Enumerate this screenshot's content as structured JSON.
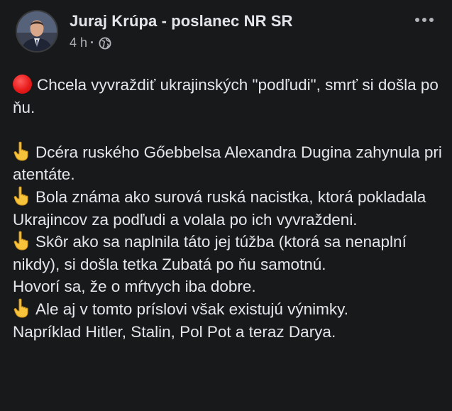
{
  "post": {
    "author": "Juraj Krúpa - poslanec NR SR",
    "time": "4 h",
    "separator": "·",
    "privacy_icon": "globe-icon",
    "more_icon": "more-options-icon",
    "avatar_icon": "profile-photo"
  },
  "body": {
    "line1": "Chcela vyvraždiť ukrajinských \"podľudi\", smrť si došla po ňu.",
    "line2": "Dcéra ruského Gőebbelsa Alexandra Dugina zahynula pri atentáte.",
    "line3": "Bola známa ako surová ruská nacistka, ktorá pokladala Ukrajincov za podľudi a volala po ich vyvraždeni.",
    "line4": "Skôr ako sa naplnila táto jej túžba (ktorá sa nenaplní nikdy), si došla tetka Zubatá po ňu samotnú.",
    "line5": "Hovorí sa, že o mŕtvych iba dobre.",
    "line6": "Ale aj v tomto príslovi však existujú výnimky.",
    "line7": "Napríklad Hitler, Stalin, Pol Pot a teraz Darya."
  },
  "icons": {
    "lead": "red-circle-icon",
    "bullet": "index-pointing-up-icon"
  },
  "colors": {
    "background": "#18191a",
    "text": "#e4e6eb",
    "secondary": "#b0b3b8",
    "red_circle": "#e81b1b",
    "hand": "#f7c33a"
  }
}
